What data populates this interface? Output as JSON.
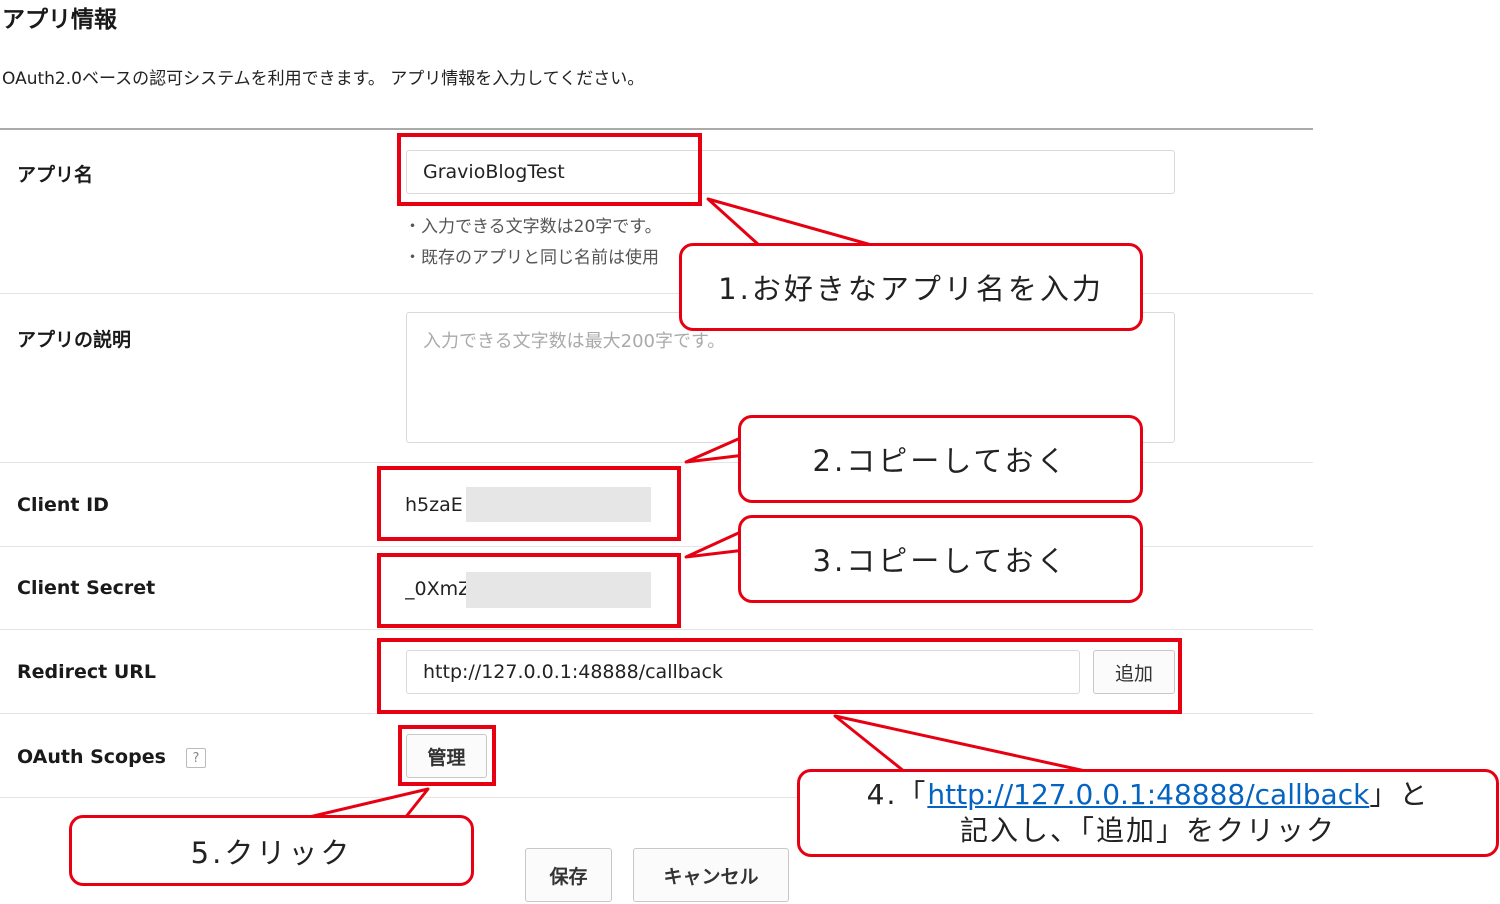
{
  "header": {
    "title": "アプリ情報",
    "description": "OAuth2.0ベースの認可システムを利用できます。 アプリ情報を入力してください。"
  },
  "form": {
    "app_name": {
      "label": "アプリ名",
      "value": "GravioBlogTest",
      "hints": [
        "・入力できる文字数は20字です。",
        "・既存のアプリと同じ名前は使用"
      ]
    },
    "app_description": {
      "label": "アプリの説明",
      "placeholder": "入力できる文字数は最大200字です。"
    },
    "client_id": {
      "label": "Client ID",
      "value": "h5zaE"
    },
    "client_secret": {
      "label": "Client Secret",
      "value": "_0XmZ"
    },
    "redirect_url": {
      "label": "Redirect URL",
      "value": "http://127.0.0.1:48888/callback",
      "add_button": "追加"
    },
    "oauth_scopes": {
      "label": "OAuth Scopes",
      "help": "?",
      "manage_button": "管理"
    }
  },
  "footer": {
    "save_button": "保存",
    "cancel_button": "キャンセル"
  },
  "annotations": {
    "step1": "1.お好きなアプリ名を入力",
    "step2": "2.コピーしておく",
    "step3": "3.コピーしておく",
    "step4_prefix": "4.「",
    "step4_link": "http://127.0.0.1:48888/callback",
    "step4_suffix": "」と",
    "step4_line2": "記入し、「追加」をクリック",
    "step5": "5.クリック"
  },
  "colors": {
    "annotation_red": "#e60012",
    "link_blue": "#0563c1",
    "divider": "#e4e4e4",
    "mask_gray": "#e6e6e6"
  }
}
